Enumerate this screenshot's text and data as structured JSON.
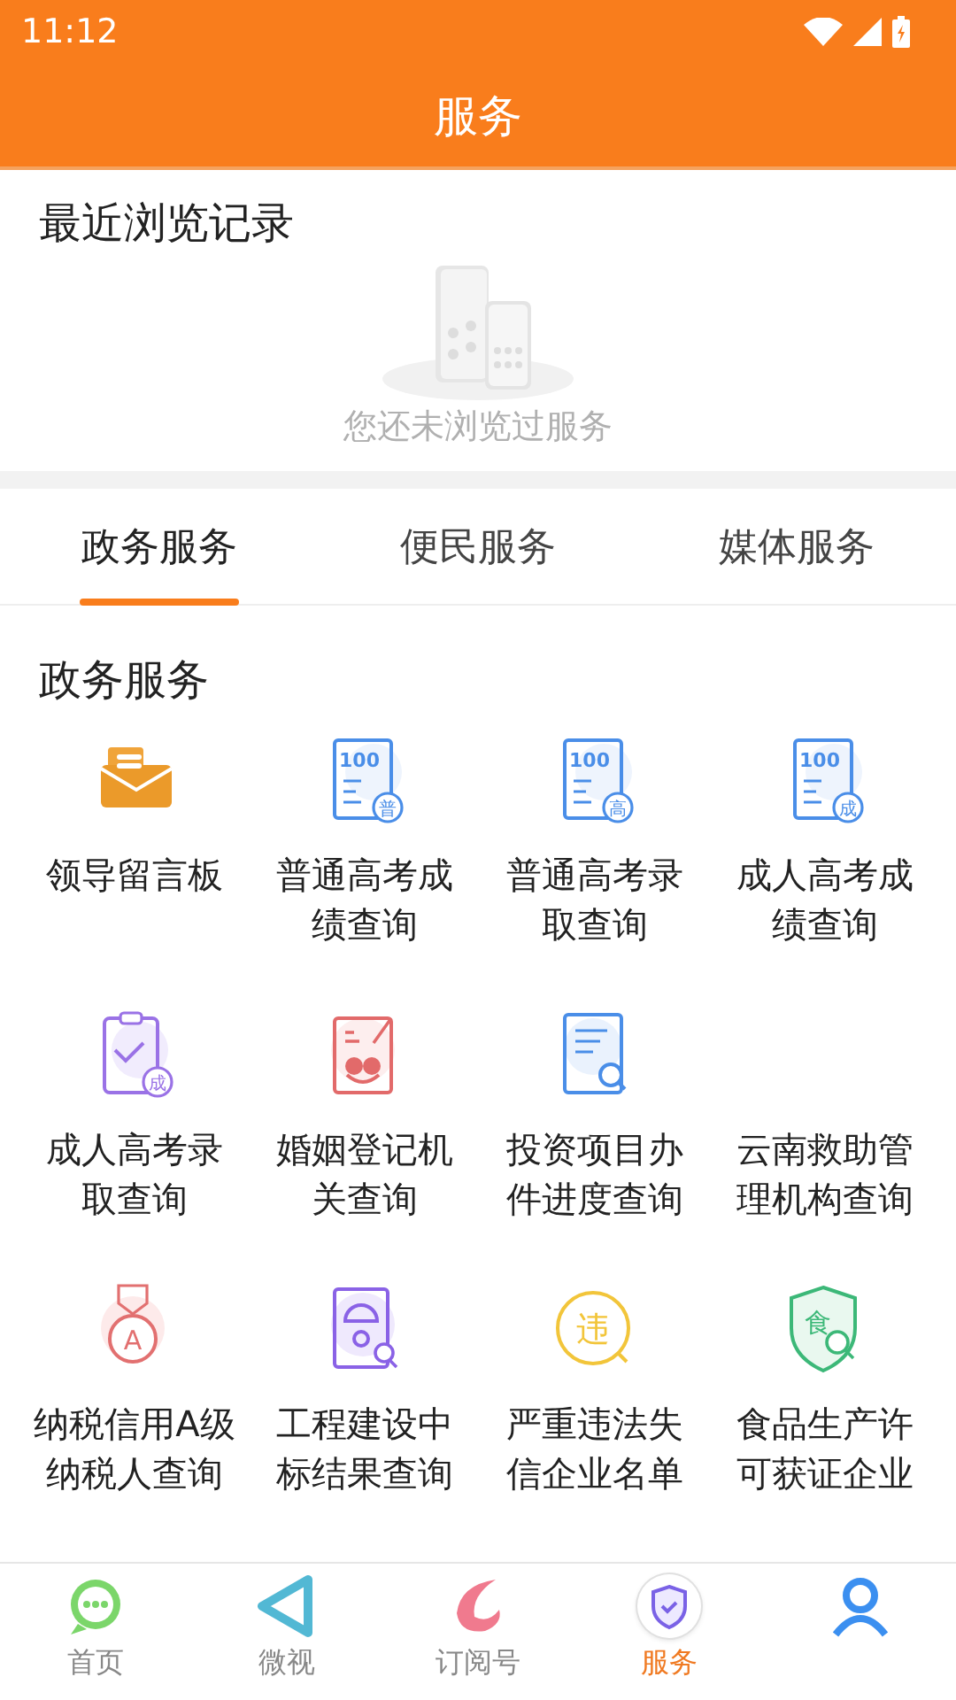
{
  "status_bar": {
    "time": "11:12"
  },
  "header": {
    "title": "服务"
  },
  "recent": {
    "title": "最近浏览记录",
    "empty_text": "您还未浏览过服务"
  },
  "tabs": [
    {
      "label": "政务服务",
      "selected": true
    },
    {
      "label": "便民服务",
      "selected": false
    },
    {
      "label": "媒体服务",
      "selected": false
    }
  ],
  "section": {
    "title": "政务服务",
    "items": [
      {
        "label": "领导留言板",
        "icon": {
          "kind": "envelope"
        }
      },
      {
        "label": "普通高考成绩查询",
        "icon": {
          "kind": "score",
          "score": "100",
          "badge": "普"
        }
      },
      {
        "label": "普通高考录取查询",
        "icon": {
          "kind": "score",
          "score": "100",
          "badge": "高"
        }
      },
      {
        "label": "成人高考成绩查询",
        "icon": {
          "kind": "score",
          "score": "100",
          "badge": "成"
        }
      },
      {
        "label": "成人高考录取查询",
        "icon": {
          "kind": "clipboard",
          "badge": "成"
        }
      },
      {
        "label": "婚姻登记机关查询",
        "icon": {
          "kind": "marriage"
        }
      },
      {
        "label": "投资项目办件进度查询",
        "icon": {
          "kind": "doc-search"
        }
      },
      {
        "label": "云南救助管理机构查询",
        "icon": {
          "kind": "none"
        }
      },
      {
        "label": "纳税信用A级纳税人查询",
        "icon": {
          "kind": "medal",
          "badge": "A"
        }
      },
      {
        "label": "工程建设中标结果查询",
        "icon": {
          "kind": "helmet"
        }
      },
      {
        "label": "严重违法失信企业名单",
        "icon": {
          "kind": "circle-char",
          "badge": "违"
        }
      },
      {
        "label": "食品生产许可获证企业",
        "icon": {
          "kind": "shield-char",
          "badge": "食"
        }
      }
    ]
  },
  "bottom_nav": [
    {
      "label": "首页",
      "selected": false
    },
    {
      "label": "微视",
      "selected": false
    },
    {
      "label": "订阅号",
      "selected": false
    },
    {
      "label": "服务",
      "selected": true
    },
    {
      "selected": false
    }
  ]
}
